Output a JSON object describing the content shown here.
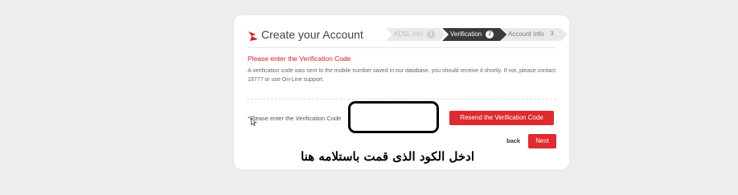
{
  "header": {
    "title": "Create your Account",
    "steps": [
      {
        "label": "ADSL Info",
        "number": "1"
      },
      {
        "label": "Verification",
        "number": "2"
      },
      {
        "label": "Account Info",
        "number": "3"
      }
    ]
  },
  "form": {
    "heading": "Please enter the Verification Code",
    "info": "A verification code was sent to the mobile number saved in our database, you should receive it shortly. If not, please contact 19777 or use On-Line support.",
    "code_required_mark": "*",
    "code_label": "Please enter the Verification Code",
    "code_value": "",
    "resend_label": "Resend the Verification Code",
    "back_label": "back",
    "next_label": "Next"
  },
  "annotation": {
    "text": "ادخل الكود الذى قمت باستلامه هنا"
  },
  "colors": {
    "accent": "#e02a2f",
    "active_step": "#3a3a3a",
    "background": "#ededed"
  }
}
